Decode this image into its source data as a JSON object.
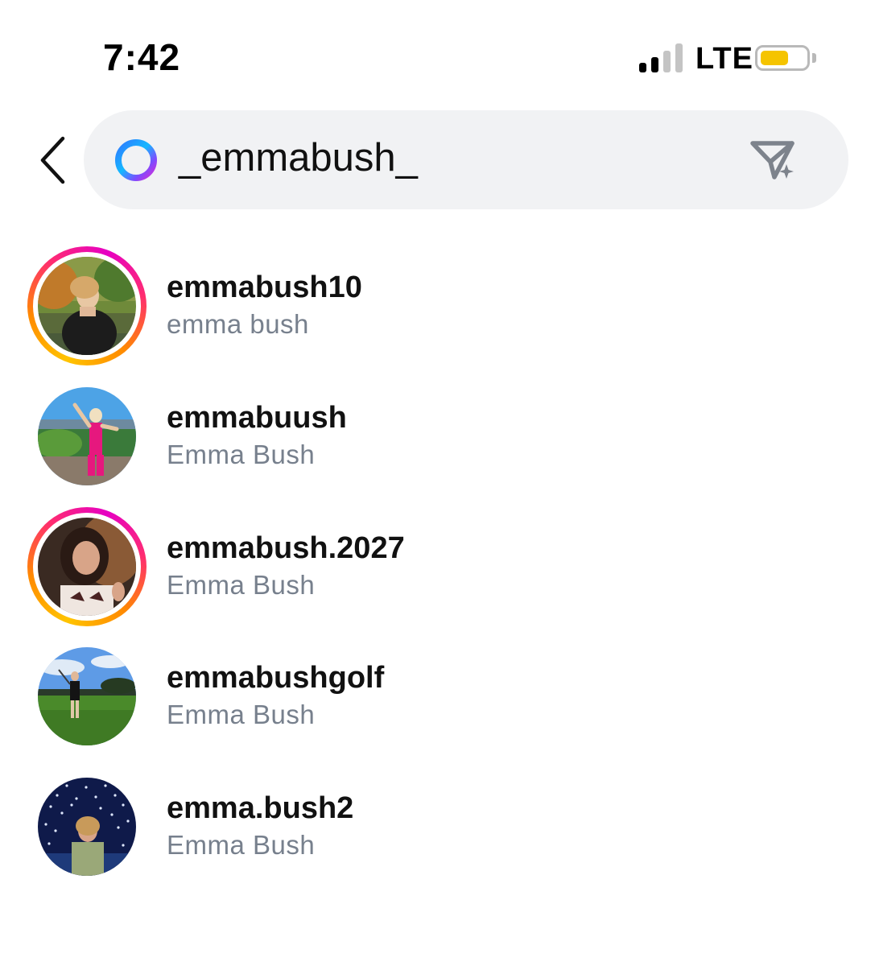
{
  "status_bar": {
    "time": "7:42",
    "network": "LTE",
    "signal_bars_active": 2,
    "signal_bars_total": 4,
    "battery_level": 0.6,
    "battery_color": "#f5c400"
  },
  "search": {
    "query": "_emmabush_",
    "leading_icon": "ai-ring-icon",
    "trailing_icon": "send-icon"
  },
  "results": [
    {
      "username": "emmabush10",
      "full_name": "emma bush",
      "has_story": true
    },
    {
      "username": "emmabuush",
      "full_name": "Emma Bush",
      "has_story": false
    },
    {
      "username": "emmabush.2027",
      "full_name": "Emma Bush",
      "has_story": true
    },
    {
      "username": "emmabushgolf",
      "full_name": "Emma Bush",
      "has_story": false
    },
    {
      "username": "emma.bush2",
      "full_name": "Emma Bush",
      "has_story": false
    }
  ],
  "colors": {
    "story_ring_start": "#ffc400",
    "story_ring_end": "#e600c3",
    "search_bg": "#f1f2f4",
    "secondary_text": "#77808d"
  }
}
